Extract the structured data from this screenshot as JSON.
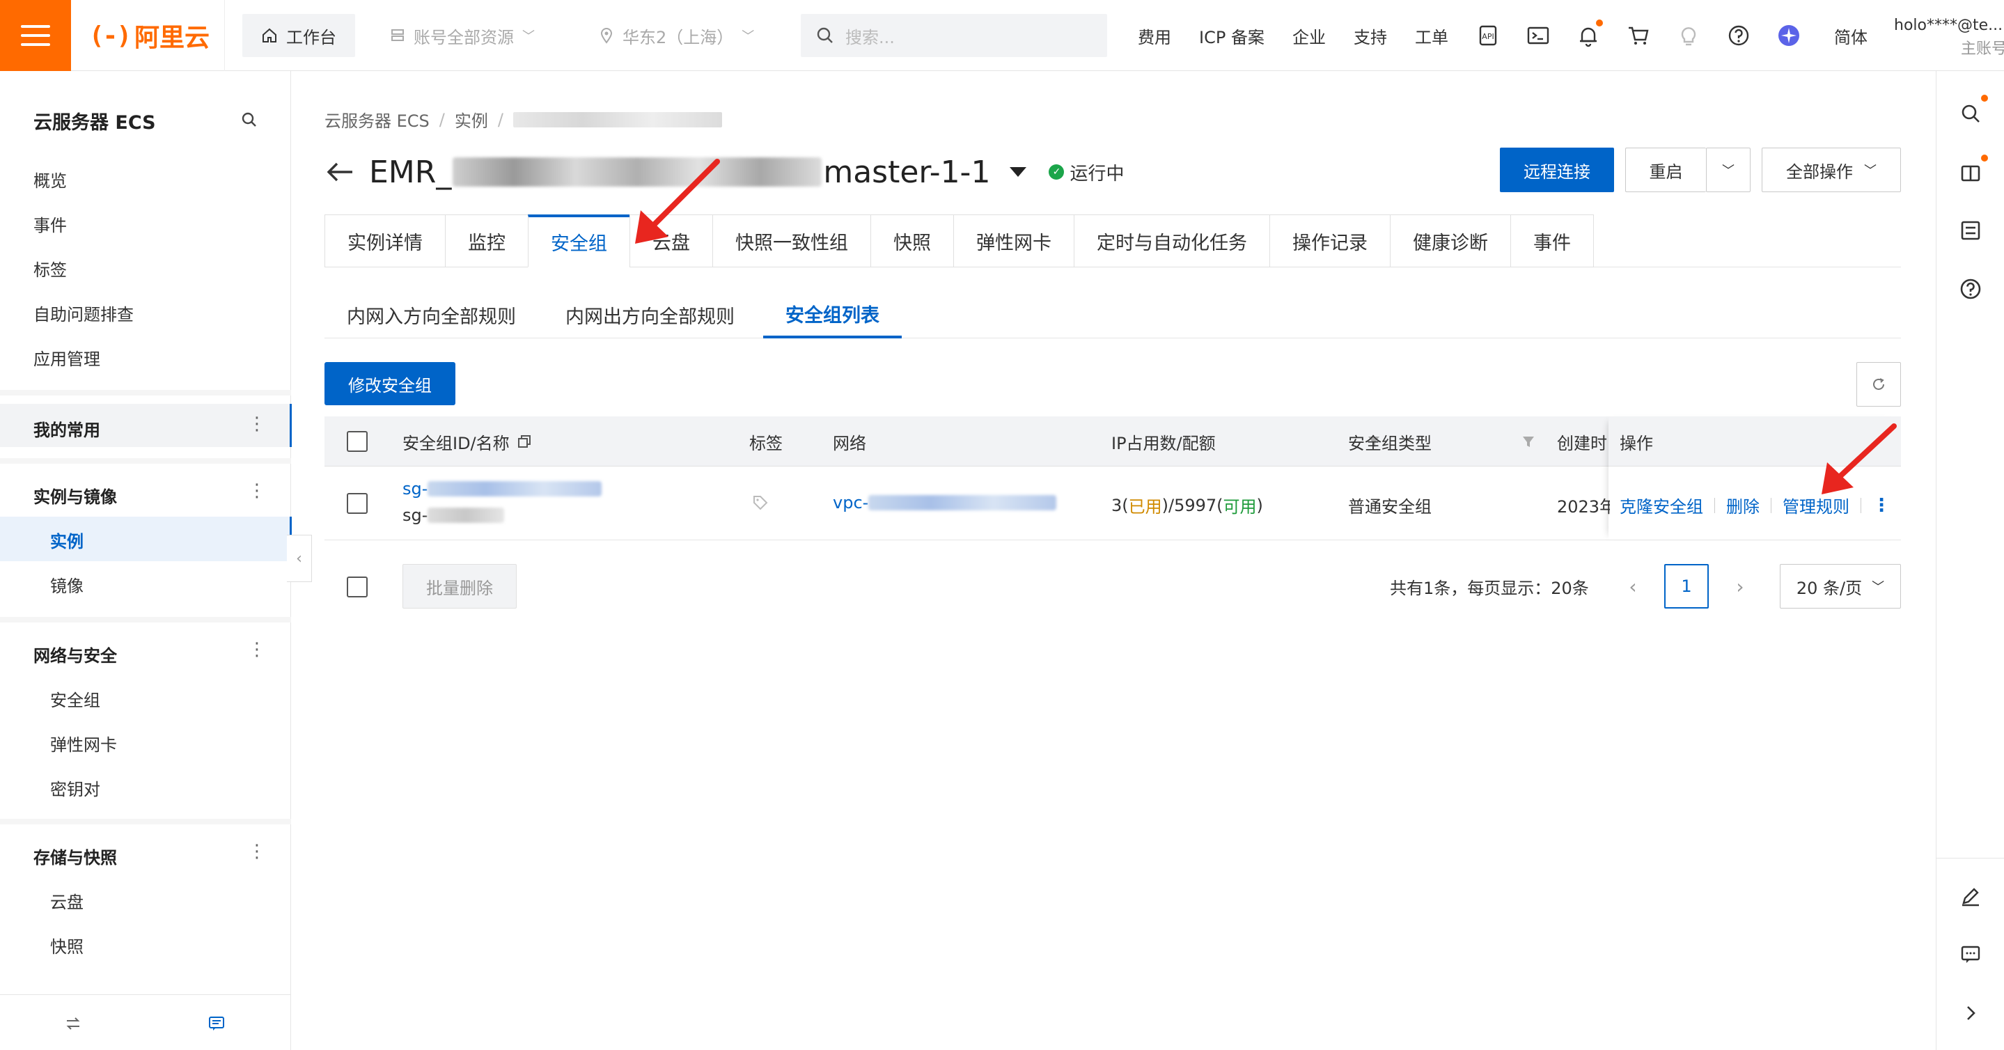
{
  "topbar": {
    "brand": "阿里云",
    "workbench": "工作台",
    "resource_scope": "账号全部资源",
    "region": "华东2（上海）",
    "search_placeholder": "搜索...",
    "nav": [
      "费用",
      "ICP 备案",
      "企业",
      "支持",
      "工单"
    ],
    "lang": "简体",
    "user": "holo****@te...",
    "user_sub": "主账号"
  },
  "sidebar": {
    "title": "云服务器 ECS",
    "items": [
      "概览",
      "事件",
      "标签",
      "自助问题排查",
      "应用管理"
    ],
    "groups": [
      {
        "label": "我的常用",
        "children": []
      },
      {
        "label": "实例与镜像",
        "children": [
          "实例",
          "镜像"
        ]
      },
      {
        "label": "网络与安全",
        "children": [
          "安全组",
          "弹性网卡",
          "密钥对"
        ]
      },
      {
        "label": "存储与快照",
        "children": [
          "云盘",
          "快照"
        ]
      }
    ]
  },
  "breadcrumb": [
    "云服务器 ECS",
    "/",
    "实例",
    "/"
  ],
  "instance": {
    "title_prefix": "EMR_",
    "title_suffix": "master-1-1",
    "status": "运行中"
  },
  "actions": {
    "remote": "远程连接",
    "restart": "重启",
    "all_ops": "全部操作"
  },
  "tabs": [
    "实例详情",
    "监控",
    "安全组",
    "云盘",
    "快照一致性组",
    "快照",
    "弹性网卡",
    "定时与自动化任务",
    "操作记录",
    "健康诊断",
    "事件"
  ],
  "subtabs": [
    "内网入方向全部规则",
    "内网出方向全部规则",
    "安全组列表"
  ],
  "modify_button": "修改安全组",
  "table": {
    "headers": [
      "安全组ID/名称",
      "标签",
      "网络",
      "IP占用数/配额",
      "安全组类型",
      "创建时",
      "操作"
    ],
    "row": {
      "id_prefix": "sg-",
      "name_prefix": "sg-",
      "network_prefix": "vpc-",
      "ip_used": "3(",
      "ip_used_label": "已用",
      "ip_mid": ")/5997(",
      "ip_avail_label": "可用",
      "ip_end": ")",
      "type": "普通安全组",
      "created": "2023年",
      "ops": [
        "克隆安全组",
        "删除",
        "管理规则"
      ]
    }
  },
  "footer": {
    "batch_delete": "批量删除",
    "summary": "共有1条，每页显示：20条",
    "page": "1",
    "page_size": "20 条/页"
  },
  "colors": {
    "brand": "#ff6a00",
    "primary": "#0064c8",
    "running": "#1ba54a",
    "used": "#d08a00",
    "available": "#1e9b3a",
    "annotation": "#e8261f"
  }
}
